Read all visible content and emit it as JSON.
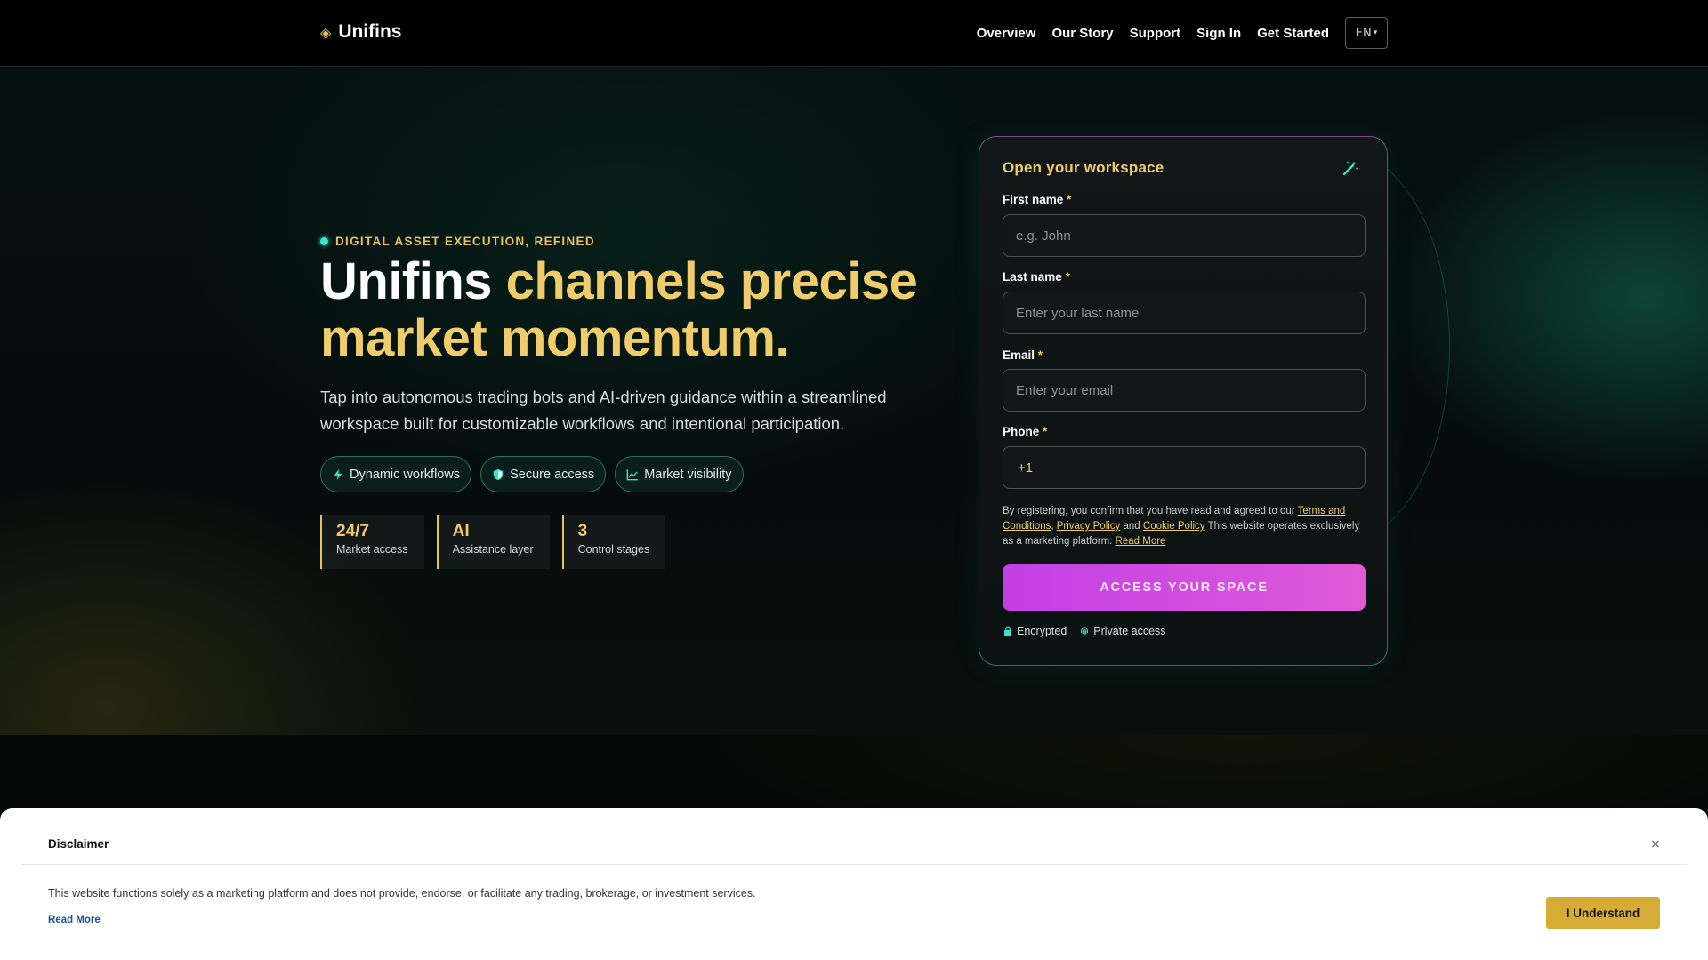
{
  "header": {
    "logo_mark": "◈",
    "logo_text": "Unifins",
    "nav": [
      "Overview",
      "Our Story",
      "Support",
      "Sign In",
      "Get Started"
    ],
    "language": "EN",
    "language_caret": "▾"
  },
  "hero": {
    "eyebrow": "DIGITAL ASSET EXECUTION, REFINED",
    "headline_white": "Unifins ",
    "headline_gold": "channels precise market momentum.",
    "lede": "Tap into autonomous trading bots and AI-driven guidance within a streamlined workspace built for customizable workflows and intentional participation.",
    "pills": [
      {
        "icon": "bolt-icon",
        "label": "Dynamic workflows"
      },
      {
        "icon": "shield-icon",
        "label": "Secure access"
      },
      {
        "icon": "chart-line-icon",
        "label": "Market visibility"
      }
    ],
    "stats": [
      {
        "value": "24/7",
        "label": "Market access"
      },
      {
        "value": "AI",
        "label": "Assistance layer"
      },
      {
        "value": "3",
        "label": "Control stages"
      }
    ]
  },
  "form": {
    "title": "Open your workspace",
    "title_icon": "magic-wand-icon",
    "first_name_label": "First name",
    "first_name_placeholder": "e.g. John",
    "last_name_label": "Last name",
    "last_name_placeholder": "Enter your last name",
    "email_label": "Email",
    "email_placeholder": "Enter your email",
    "phone_label": "Phone",
    "phone_code": "+1",
    "required_mark": "*",
    "consent_prefix": "By registering, you confirm that you have read and agreed to our ",
    "terms_link": "Terms and Conditions",
    "comma": ", ",
    "privacy_link": "Privacy Policy",
    "and": " and ",
    "cookie_link": "Cookie Policy",
    "consent_suffix": " This website operates exclusively as a marketing platform. ",
    "read_more_link": "Read More",
    "submit_label": "ACCESS YOUR SPACE",
    "trust_encrypted": "Encrypted",
    "trust_private": "Private access"
  },
  "disclaimer": {
    "title": "Disclaimer",
    "close_glyph": "×",
    "text": "This website functions solely as a marketing platform and does not provide, endorse, or facilitate any trading, brokerage, or investment services.",
    "read_more": "Read More",
    "button": "I Understand"
  },
  "colors": {
    "accent_gold": "#f0cd6a",
    "accent_teal": "#3be3c7",
    "cta_magenta": "#c23fe6",
    "disclaimer_button": "#d6ac34"
  }
}
